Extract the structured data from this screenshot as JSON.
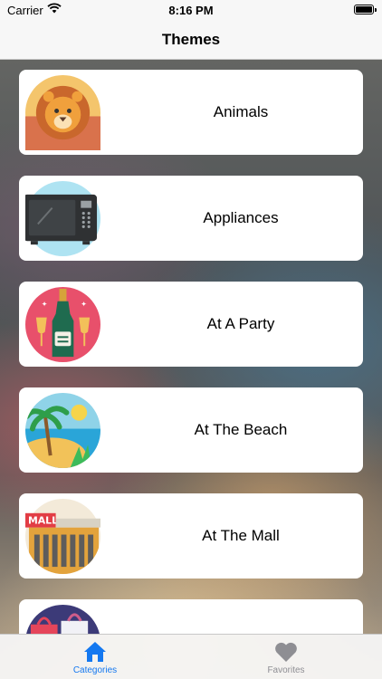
{
  "status_bar": {
    "carrier": "Carrier",
    "time": "8:16 PM"
  },
  "nav": {
    "title": "Themes"
  },
  "themes": [
    {
      "label": "Animals",
      "icon": "lion-icon"
    },
    {
      "label": "Appliances",
      "icon": "microwave-icon"
    },
    {
      "label": "At A Party",
      "icon": "champagne-icon"
    },
    {
      "label": "At The Beach",
      "icon": "beach-icon"
    },
    {
      "label": "At The Mall",
      "icon": "mall-icon"
    },
    {
      "label": "",
      "icon": "shopping-bags-icon"
    }
  ],
  "tab_bar": {
    "tabs": [
      {
        "label": "Categories",
        "icon": "home-icon",
        "selected": true
      },
      {
        "label": "Favorites",
        "icon": "heart-icon",
        "selected": false
      }
    ]
  },
  "colors": {
    "accent": "#1478f0",
    "inactive": "#8e8e93"
  }
}
